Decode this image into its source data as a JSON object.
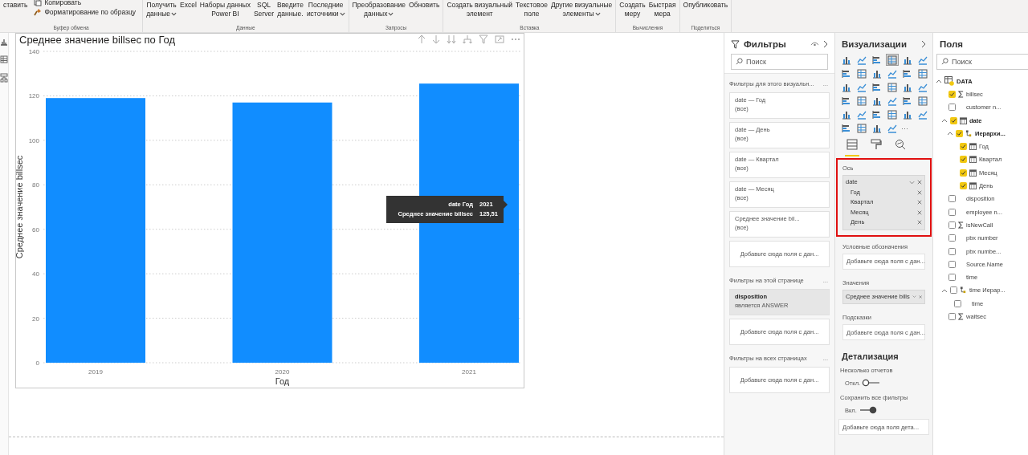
{
  "ribbon": {
    "groups": [
      {
        "label": "Буфер обмена",
        "buttons": [
          {
            "label": "ставить",
            "kind": "large",
            "dropdown": false
          },
          {
            "label": "Копировать",
            "kind": "small",
            "dropdown": false
          },
          {
            "label": "Форматирование по образцу",
            "kind": "small",
            "dropdown": false
          }
        ]
      },
      {
        "label": "Данные",
        "buttons": [
          {
            "label": "Получить\nданные",
            "kind": "large",
            "dropdown": true
          },
          {
            "label": "Excel",
            "kind": "large",
            "dropdown": false
          },
          {
            "label": "Наборы данных\nPower BI",
            "kind": "large",
            "dropdown": false
          },
          {
            "label": "SQL\nServer",
            "kind": "large",
            "dropdown": false
          },
          {
            "label": "Введите\nданные.",
            "kind": "large",
            "dropdown": false
          },
          {
            "label": "Последние\nисточники",
            "kind": "large",
            "dropdown": true
          }
        ]
      },
      {
        "label": "Запросы",
        "buttons": [
          {
            "label": "Преобразование\nданных",
            "kind": "large",
            "dropdown": true
          },
          {
            "label": "Обновить",
            "kind": "large",
            "dropdown": false
          }
        ]
      },
      {
        "label": "Вставка",
        "buttons": [
          {
            "label": "Создать визуальный\nэлемент",
            "kind": "large",
            "dropdown": false
          },
          {
            "label": "Текстовое\nполе",
            "kind": "large",
            "dropdown": false
          },
          {
            "label": "Другие визуальные\nэлементы",
            "kind": "large",
            "dropdown": true
          }
        ]
      },
      {
        "label": "Вычисления",
        "buttons": [
          {
            "label": "Создать\nмеру",
            "kind": "large",
            "dropdown": false
          },
          {
            "label": "Быстрая\nмера",
            "kind": "large",
            "dropdown": false
          }
        ]
      },
      {
        "label": "Поделиться",
        "buttons": [
          {
            "label": "Опубликовать",
            "kind": "large",
            "dropdown": false
          }
        ]
      }
    ]
  },
  "visual": {
    "chart_data": {
      "type": "bar",
      "title": "Среднее значение billsec по Год",
      "xlabel": "Год",
      "ylabel": "Среднее значение billsec",
      "categories": [
        "2019",
        "2020",
        "2021"
      ],
      "series": [
        {
          "color": "#118dff",
          "values": [
            119,
            117,
            125.51
          ]
        }
      ],
      "grid": true,
      "ylim": [
        0,
        140
      ],
      "yticks": [
        0,
        20,
        40,
        60,
        80,
        100,
        120,
        140
      ]
    },
    "tooltip": {
      "rows": [
        {
          "label": "date Год",
          "value": "2021"
        },
        {
          "label": "Среднее значение billsec",
          "value": "125,51"
        }
      ]
    }
  },
  "filters": {
    "title": "Фильтры",
    "search": {
      "placeholder": "Поиск"
    },
    "sections": [
      {
        "heading": "Фильтры для этого визуальн...",
        "more": "...",
        "cards": [
          {
            "title": "date — Год",
            "value": "(все)",
            "applied": false
          },
          {
            "title": "date — День",
            "value": "(все)",
            "applied": false
          },
          {
            "title": "date — Квартал",
            "value": "(все)",
            "applied": false
          },
          {
            "title": "date — Месяц",
            "value": "(все)",
            "applied": false
          },
          {
            "title": "Среднее значение bil...",
            "value": "(все)",
            "applied": false
          }
        ],
        "drop": "Добавьте сюда поля с дан..."
      },
      {
        "heading": "Фильтры на этой странице",
        "more": "...",
        "cards": [
          {
            "title": "disposition",
            "value": "является ANSWER",
            "applied": true
          }
        ],
        "drop": "Добавьте сюда поля с дан..."
      },
      {
        "heading": "Фильтры на всех страницах",
        "more": "...",
        "drop": "Добавьте сюда поля с дан..."
      }
    ]
  },
  "visualizations": {
    "title": "Визуализации",
    "types": [
      {
        "selected": false
      },
      {
        "selected": false
      },
      {
        "selected": false
      },
      {
        "selected": true
      },
      {
        "selected": false
      },
      {
        "selected": false
      },
      {
        "selected": false
      },
      {
        "selected": false
      },
      {
        "selected": false
      },
      {
        "selected": false
      },
      {
        "selected": false
      },
      {
        "selected": false
      },
      {
        "selected": false
      },
      {
        "selected": false
      },
      {
        "selected": false
      },
      {
        "selected": false
      },
      {
        "selected": false
      },
      {
        "selected": false
      },
      {
        "selected": false
      },
      {
        "selected": false
      },
      {
        "selected": false
      },
      {
        "selected": false
      },
      {
        "selected": false
      },
      {
        "selected": false
      },
      {
        "selected": false
      },
      {
        "selected": false
      },
      {
        "selected": false
      },
      {
        "selected": false
      },
      {
        "selected": false
      },
      {
        "selected": false
      },
      {
        "selected": false
      },
      {
        "selected": false
      },
      {
        "selected": false
      },
      {
        "selected": false
      }
    ],
    "more": "···",
    "pane_tabs": [
      {
        "selected": true
      },
      {
        "selected": false
      },
      {
        "selected": false
      }
    ],
    "wells": [
      {
        "label": "Ось",
        "highlighted": true,
        "field": {
          "name": "date",
          "children": [
            "Год",
            "Квартал",
            "Месяц",
            "День"
          ]
        }
      },
      {
        "label": "Условные обозначения",
        "highlighted": false,
        "placeholder": "Добавьте сюда поля с дан..."
      },
      {
        "label": "Значения",
        "highlighted": false,
        "field": {
          "name": "Среднее значение bills"
        }
      },
      {
        "label": "Подсказки",
        "highlighted": false,
        "placeholder": "Добавьте сюда поля с дан..."
      }
    ],
    "drillthrough": {
      "heading": "Детализация",
      "toggles": [
        {
          "label": "Несколько отчетов",
          "state": "Откл.",
          "on": false
        },
        {
          "label": "Сохранить все фильтры",
          "state": "Вкл.",
          "on": true
        }
      ],
      "drop": "Добавьте сюда поля дета..."
    }
  },
  "fields": {
    "title": "Поля",
    "search": {
      "placeholder": "Поиск"
    },
    "tree": [
      {
        "label": "DATA",
        "kind": "table",
        "checked": true,
        "expanded": true,
        "children": [
          {
            "label": "billsec",
            "kind": "measure",
            "checked": true
          },
          {
            "label": "customer n...",
            "kind": "column",
            "checked": false
          },
          {
            "label": "date",
            "kind": "date",
            "checked": true,
            "expanded": true,
            "children": [
              {
                "label": "Иерархи...",
                "kind": "hierarchy",
                "checked": true,
                "expanded": true,
                "children": [
                  {
                    "label": "Год",
                    "kind": "level",
                    "checked": true
                  },
                  {
                    "label": "Квартал",
                    "kind": "level",
                    "checked": true
                  },
                  {
                    "label": "Месяц",
                    "kind": "level",
                    "checked": true
                  },
                  {
                    "label": "День",
                    "kind": "level",
                    "checked": true
                  }
                ]
              }
            ]
          },
          {
            "label": "disposition",
            "kind": "column",
            "checked": false
          },
          {
            "label": "employee n...",
            "kind": "column",
            "checked": false
          },
          {
            "label": "isNewCall",
            "kind": "measure",
            "checked": false
          },
          {
            "label": "pbx number",
            "kind": "column",
            "checked": false
          },
          {
            "label": "pbx numbe...",
            "kind": "column",
            "checked": false
          },
          {
            "label": "Source.Name",
            "kind": "column",
            "checked": false
          },
          {
            "label": "time",
            "kind": "column",
            "checked": false
          },
          {
            "label": "time Иерар...",
            "kind": "hierarchy",
            "checked": false,
            "expanded": true,
            "children": [
              {
                "label": "time",
                "kind": "column",
                "checked": false
              }
            ]
          },
          {
            "label": "waitsec",
            "kind": "measure",
            "checked": false
          }
        ]
      }
    ]
  }
}
